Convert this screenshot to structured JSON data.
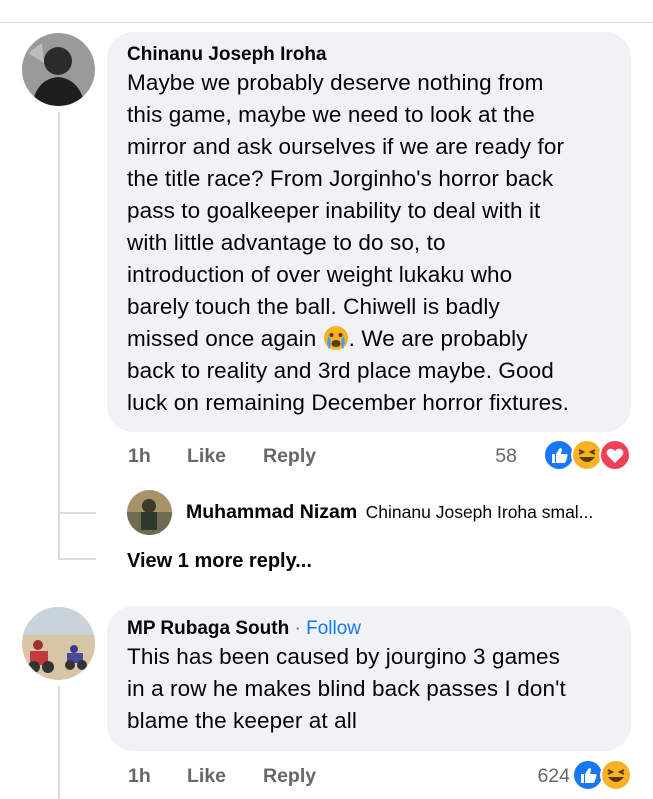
{
  "comments": [
    {
      "author": "Chinanu Joseph Iroha",
      "body_lines": [
        "Maybe we probably deserve nothing from",
        "this game, maybe we need to look at the",
        "mirror and ask ourselves if we are ready for",
        "the title race? From Jorginho's horror back",
        "pass to goalkeeper inability to deal with it",
        "with little advantage to do so, to",
        "introduction of over weight lukaku who",
        "barely touch the ball. Chiwell is badly"
      ],
      "line_with_emoji_before": "missed once again ",
      "line_with_emoji_after": ". We are probably",
      "body_end_lines": [
        "back to reality and 3rd place maybe. Good",
        "luck on remaining December horror fixtures."
      ],
      "time": "1h",
      "like": "Like",
      "reply": "Reply",
      "reaction_count": "58",
      "reactions": [
        "like",
        "haha",
        "love"
      ]
    },
    {
      "author": "MP Rubaga South",
      "separator": " · ",
      "follow": "Follow",
      "body_lines": [
        "This has been caused by jourgino 3 games",
        "in a row he makes blind back passes I don't",
        "blame the keeper at all"
      ],
      "time": "1h",
      "like": "Like",
      "reply": "Reply",
      "reaction_count": "624",
      "reactions": [
        "like",
        "haha"
      ]
    }
  ],
  "reply_preview": {
    "author": "Muhammad Nizam",
    "snippet": "Chinanu Joseph Iroha smal..."
  },
  "view_more": "View 1 more reply...",
  "colors": {
    "bubble": "#f0f2f5",
    "meta": "#65676b",
    "link": "#1877f2",
    "like_blue": "#1877f2",
    "love_red": "#f33e58",
    "haha_yellow": "#f7b125"
  }
}
